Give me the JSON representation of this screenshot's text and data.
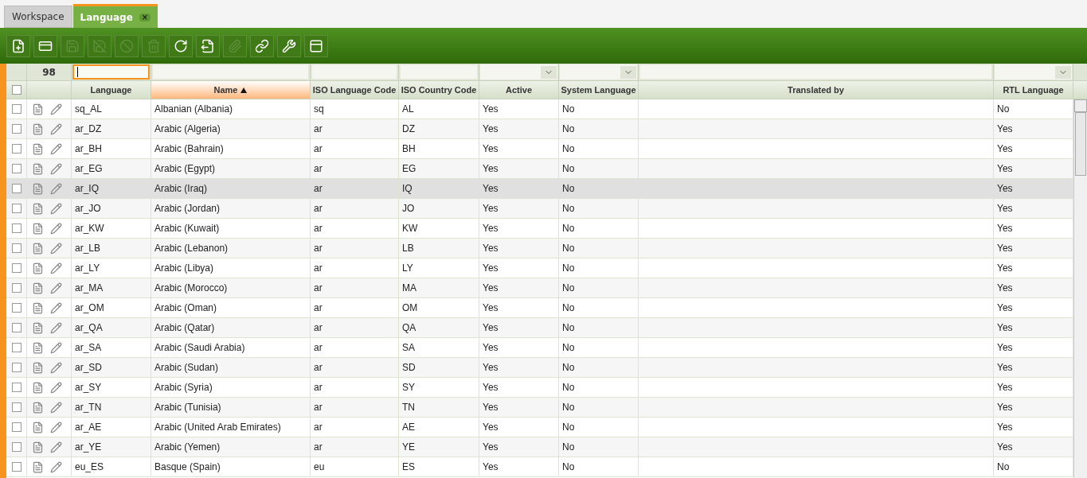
{
  "tabs": [
    {
      "label": "Workspace",
      "selected": false
    },
    {
      "label": "Language",
      "selected": true,
      "close_icon": "×"
    }
  ],
  "select_all": {
    "checked": false
  },
  "toolbar": [
    {
      "kind": "new",
      "disabled": false
    },
    {
      "kind": "grid-new",
      "disabled": false
    },
    {
      "kind": "save",
      "disabled": true
    },
    {
      "kind": "save-close",
      "disabled": true
    },
    {
      "kind": "ignore",
      "disabled": true
    },
    {
      "kind": "delete",
      "disabled": true
    },
    {
      "kind": "refresh",
      "disabled": false
    },
    {
      "kind": "export",
      "disabled": false
    },
    {
      "kind": "attach",
      "disabled": true
    },
    {
      "kind": "link",
      "disabled": false
    },
    {
      "kind": "customize",
      "disabled": false
    },
    {
      "kind": "toggle",
      "disabled": false
    }
  ],
  "record_count": "98",
  "filters": [
    {
      "kind": "text",
      "focused": true
    },
    {
      "kind": "text",
      "focused": false
    },
    {
      "kind": "text",
      "focused": false
    },
    {
      "kind": "text",
      "focused": false
    },
    {
      "kind": "select",
      "focused": false
    },
    {
      "kind": "select",
      "focused": false
    },
    {
      "kind": "text",
      "focused": false
    },
    {
      "kind": "select",
      "focused": false
    }
  ],
  "columns": [
    {
      "label": "Language",
      "sorted": false
    },
    {
      "label": "Name",
      "sorted": true
    },
    {
      "label": "ISO Language Code",
      "sorted": false
    },
    {
      "label": "ISO Country Code",
      "sorted": false
    },
    {
      "label": "Active",
      "sorted": false
    },
    {
      "label": "System Language",
      "sorted": false
    },
    {
      "label": "Translated by",
      "sorted": false
    },
    {
      "label": "RTL Language",
      "sorted": false
    }
  ],
  "rows": [
    {
      "cells": [
        "sq_AL",
        "Albanian (Albania)",
        "sq",
        "AL",
        "Yes",
        "No",
        "",
        "No"
      ],
      "selected": false
    },
    {
      "cells": [
        "ar_DZ",
        "Arabic (Algeria)",
        "ar",
        "DZ",
        "Yes",
        "No",
        "",
        "Yes"
      ],
      "selected": false
    },
    {
      "cells": [
        "ar_BH",
        "Arabic (Bahrain)",
        "ar",
        "BH",
        "Yes",
        "No",
        "",
        "Yes"
      ],
      "selected": false
    },
    {
      "cells": [
        "ar_EG",
        "Arabic (Egypt)",
        "ar",
        "EG",
        "Yes",
        "No",
        "",
        "Yes"
      ],
      "selected": false
    },
    {
      "cells": [
        "ar_IQ",
        "Arabic (Iraq)",
        "ar",
        "IQ",
        "Yes",
        "No",
        "",
        "Yes"
      ],
      "selected": true
    },
    {
      "cells": [
        "ar_JO",
        "Arabic (Jordan)",
        "ar",
        "JO",
        "Yes",
        "No",
        "",
        "Yes"
      ],
      "selected": false
    },
    {
      "cells": [
        "ar_KW",
        "Arabic (Kuwait)",
        "ar",
        "KW",
        "Yes",
        "No",
        "",
        "Yes"
      ],
      "selected": false
    },
    {
      "cells": [
        "ar_LB",
        "Arabic (Lebanon)",
        "ar",
        "LB",
        "Yes",
        "No",
        "",
        "Yes"
      ],
      "selected": false
    },
    {
      "cells": [
        "ar_LY",
        "Arabic (Libya)",
        "ar",
        "LY",
        "Yes",
        "No",
        "",
        "Yes"
      ],
      "selected": false
    },
    {
      "cells": [
        "ar_MA",
        "Arabic (Morocco)",
        "ar",
        "MA",
        "Yes",
        "No",
        "",
        "Yes"
      ],
      "selected": false
    },
    {
      "cells": [
        "ar_OM",
        "Arabic (Oman)",
        "ar",
        "OM",
        "Yes",
        "No",
        "",
        "Yes"
      ],
      "selected": false
    },
    {
      "cells": [
        "ar_QA",
        "Arabic (Qatar)",
        "ar",
        "QA",
        "Yes",
        "No",
        "",
        "Yes"
      ],
      "selected": false
    },
    {
      "cells": [
        "ar_SA",
        "Arabic (Saudi Arabia)",
        "ar",
        "SA",
        "Yes",
        "No",
        "",
        "Yes"
      ],
      "selected": false
    },
    {
      "cells": [
        "ar_SD",
        "Arabic (Sudan)",
        "ar",
        "SD",
        "Yes",
        "No",
        "",
        "Yes"
      ],
      "selected": false
    },
    {
      "cells": [
        "ar_SY",
        "Arabic (Syria)",
        "ar",
        "SY",
        "Yes",
        "No",
        "",
        "Yes"
      ],
      "selected": false
    },
    {
      "cells": [
        "ar_TN",
        "Arabic (Tunisia)",
        "ar",
        "TN",
        "Yes",
        "No",
        "",
        "Yes"
      ],
      "selected": false
    },
    {
      "cells": [
        "ar_AE",
        "Arabic (United Arab Emirates)",
        "ar",
        "AE",
        "Yes",
        "No",
        "",
        "Yes"
      ],
      "selected": false
    },
    {
      "cells": [
        "ar_YE",
        "Arabic (Yemen)",
        "ar",
        "YE",
        "Yes",
        "No",
        "",
        "Yes"
      ],
      "selected": false
    },
    {
      "cells": [
        "eu_ES",
        "Basque (Spain)",
        "eu",
        "ES",
        "Yes",
        "No",
        "",
        "No"
      ],
      "selected": false
    }
  ]
}
